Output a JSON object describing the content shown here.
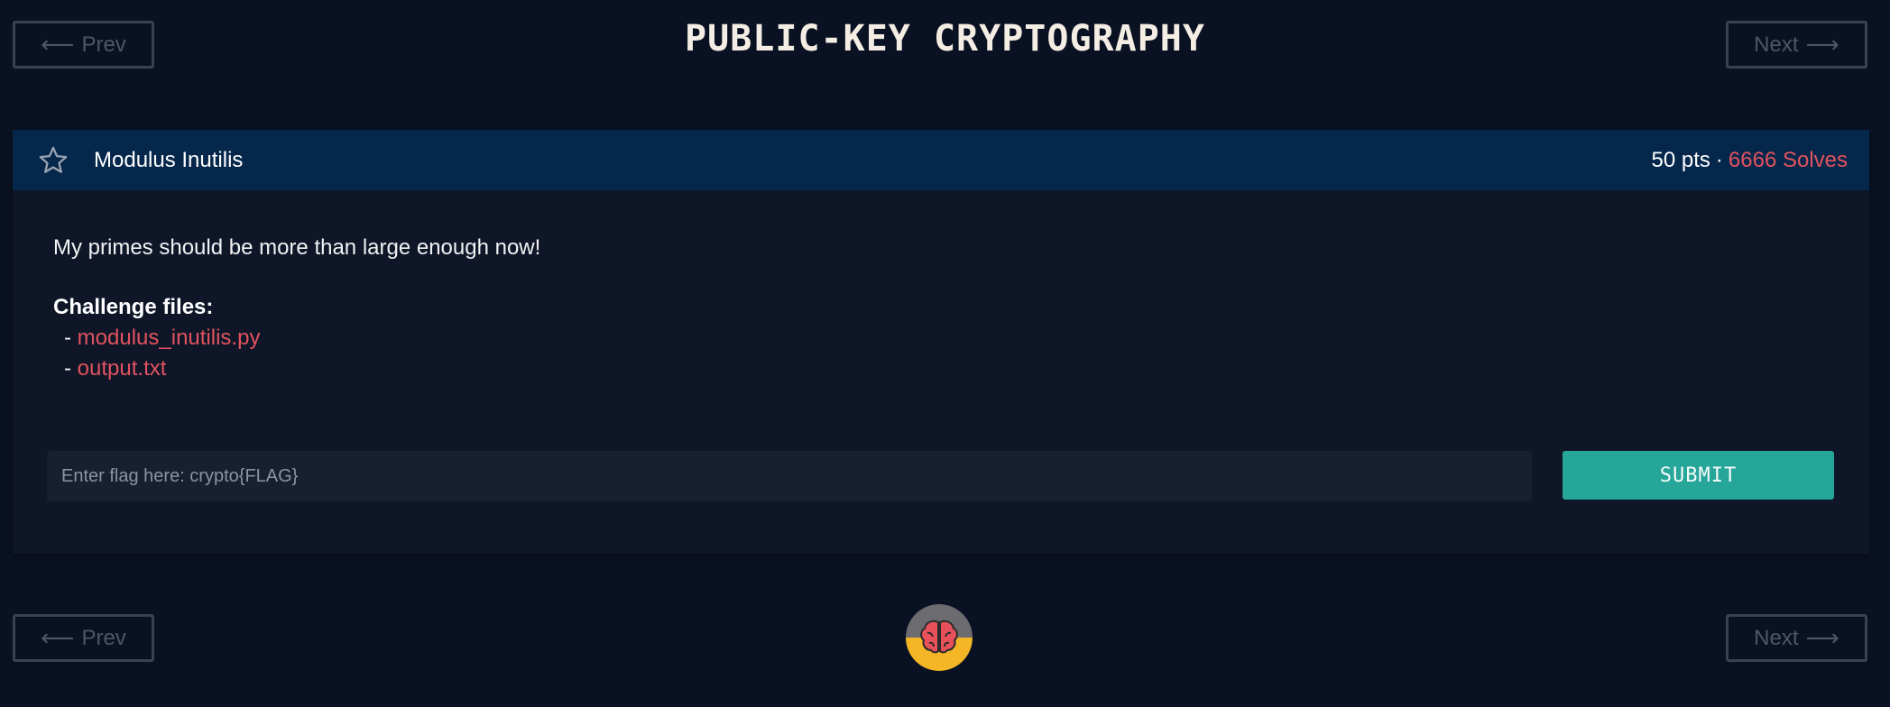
{
  "nav": {
    "prev_label": "Prev",
    "next_label": "Next",
    "prev_arrow": "⟵",
    "next_arrow": "⟶"
  },
  "page": {
    "title": "PUBLIC-KEY CRYPTOGRAPHY"
  },
  "challenge": {
    "name": "Modulus Inutilis",
    "points": "50 pts",
    "separator": "·",
    "solves": "6666 Solves",
    "description": "My primes should be more than large enough now!",
    "files_title": "Challenge files:",
    "files": [
      {
        "prefix": "- ",
        "label": "modulus_inutilis.py"
      },
      {
        "prefix": "- ",
        "label": "output.txt"
      }
    ]
  },
  "flag_form": {
    "placeholder": "Enter flag here: crypto{FLAG}",
    "value": "",
    "submit_label": "SUBMIT"
  },
  "icons": {
    "favorite": "star-outline-icon",
    "footer": "brain-icon"
  },
  "colors": {
    "background": "#0a1122",
    "header": "#05274b",
    "accent_red": "#e2535f",
    "submit_green": "#26a699",
    "brain_top": "#6b6b70",
    "brain_bottom": "#f5b625"
  }
}
